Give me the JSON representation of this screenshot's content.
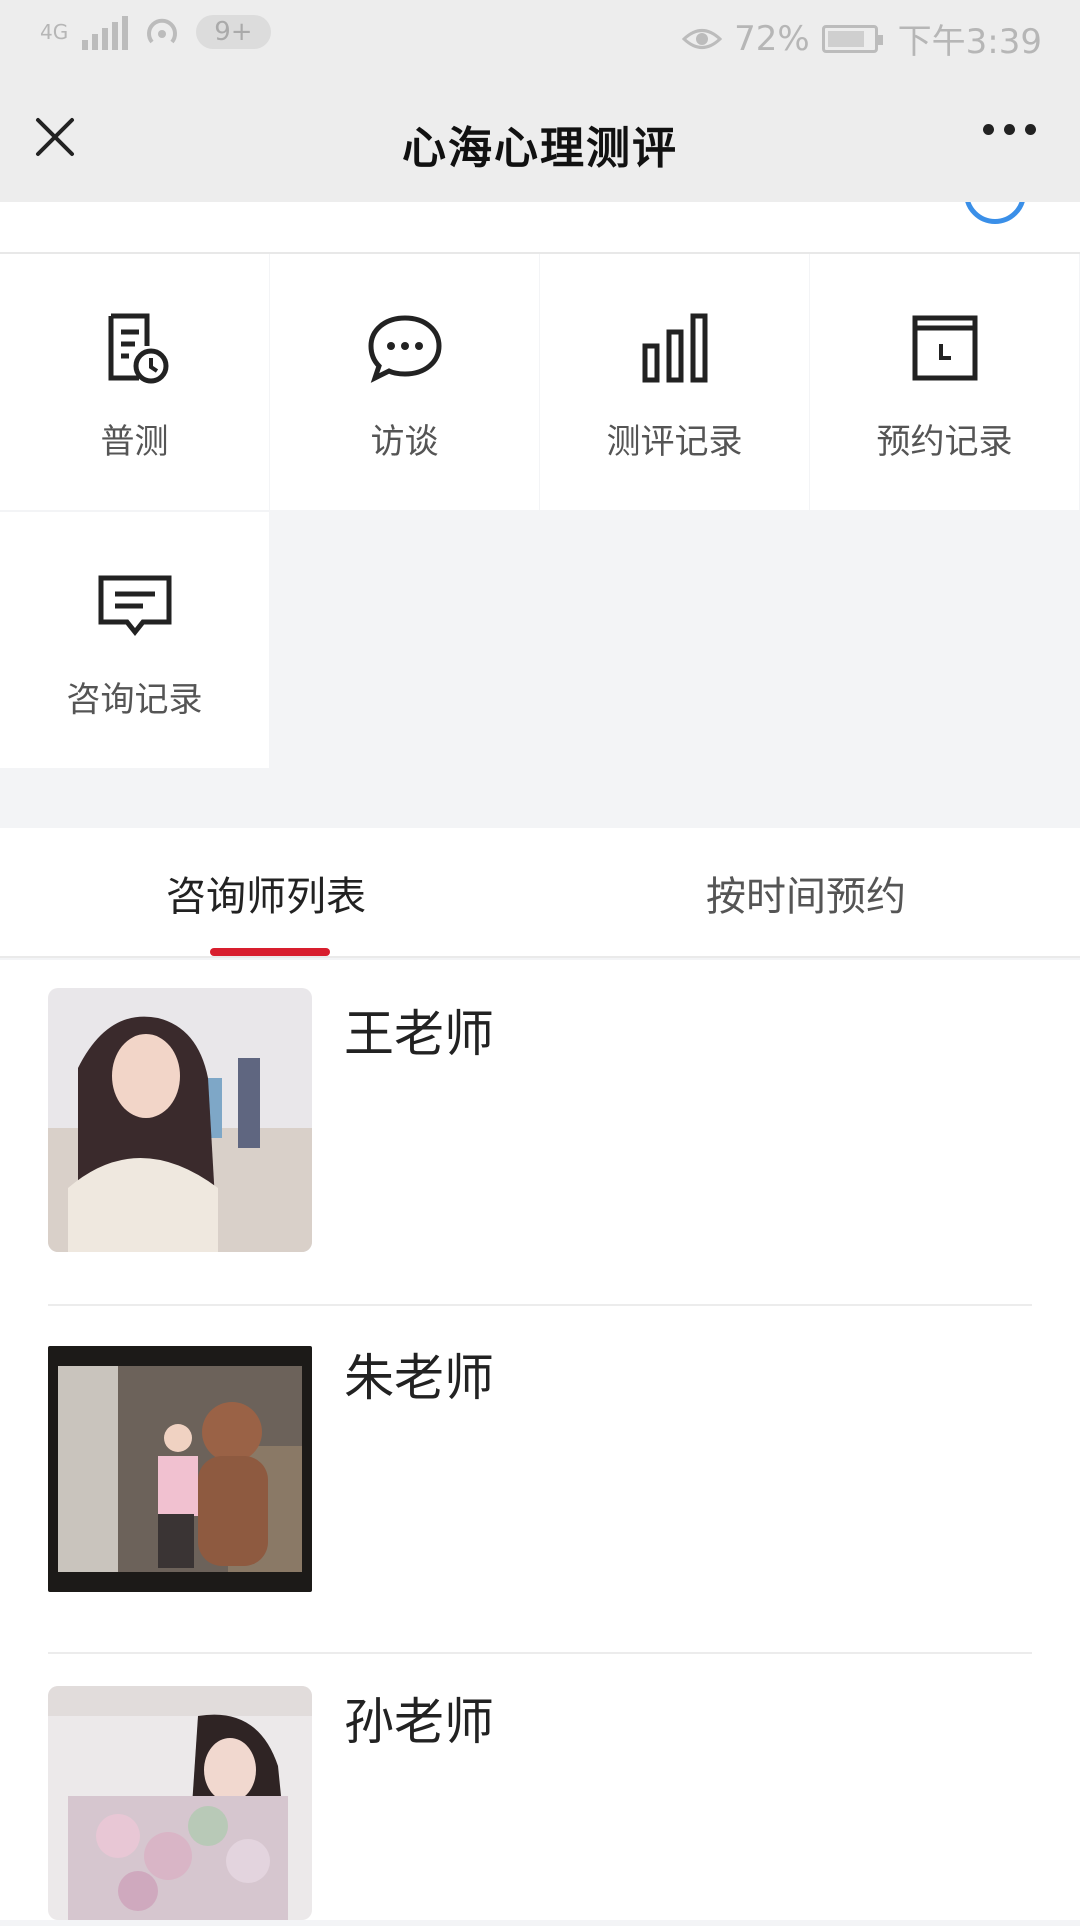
{
  "status_bar": {
    "network": "4G",
    "notification_badge": "9+",
    "battery": "72%",
    "time": "下午3:39"
  },
  "nav": {
    "title": "心海心理测评"
  },
  "grid_items": [
    {
      "label": "普测",
      "icon": "report-clock-icon"
    },
    {
      "label": "访谈",
      "icon": "chat-bubble-icon"
    },
    {
      "label": "测评记录",
      "icon": "bar-chart-icon"
    },
    {
      "label": "预约记录",
      "icon": "calendar-clock-icon"
    },
    {
      "label": "咨询记录",
      "icon": "message-box-icon"
    }
  ],
  "tabs": [
    {
      "label": "咨询师列表",
      "active": true
    },
    {
      "label": "按时间预约",
      "active": false
    }
  ],
  "counselors": [
    {
      "name": "王老师"
    },
    {
      "name": "朱老师"
    },
    {
      "name": "孙老师"
    }
  ],
  "colors": {
    "accent": "#d81e2e",
    "link": "#3a8fe8"
  }
}
